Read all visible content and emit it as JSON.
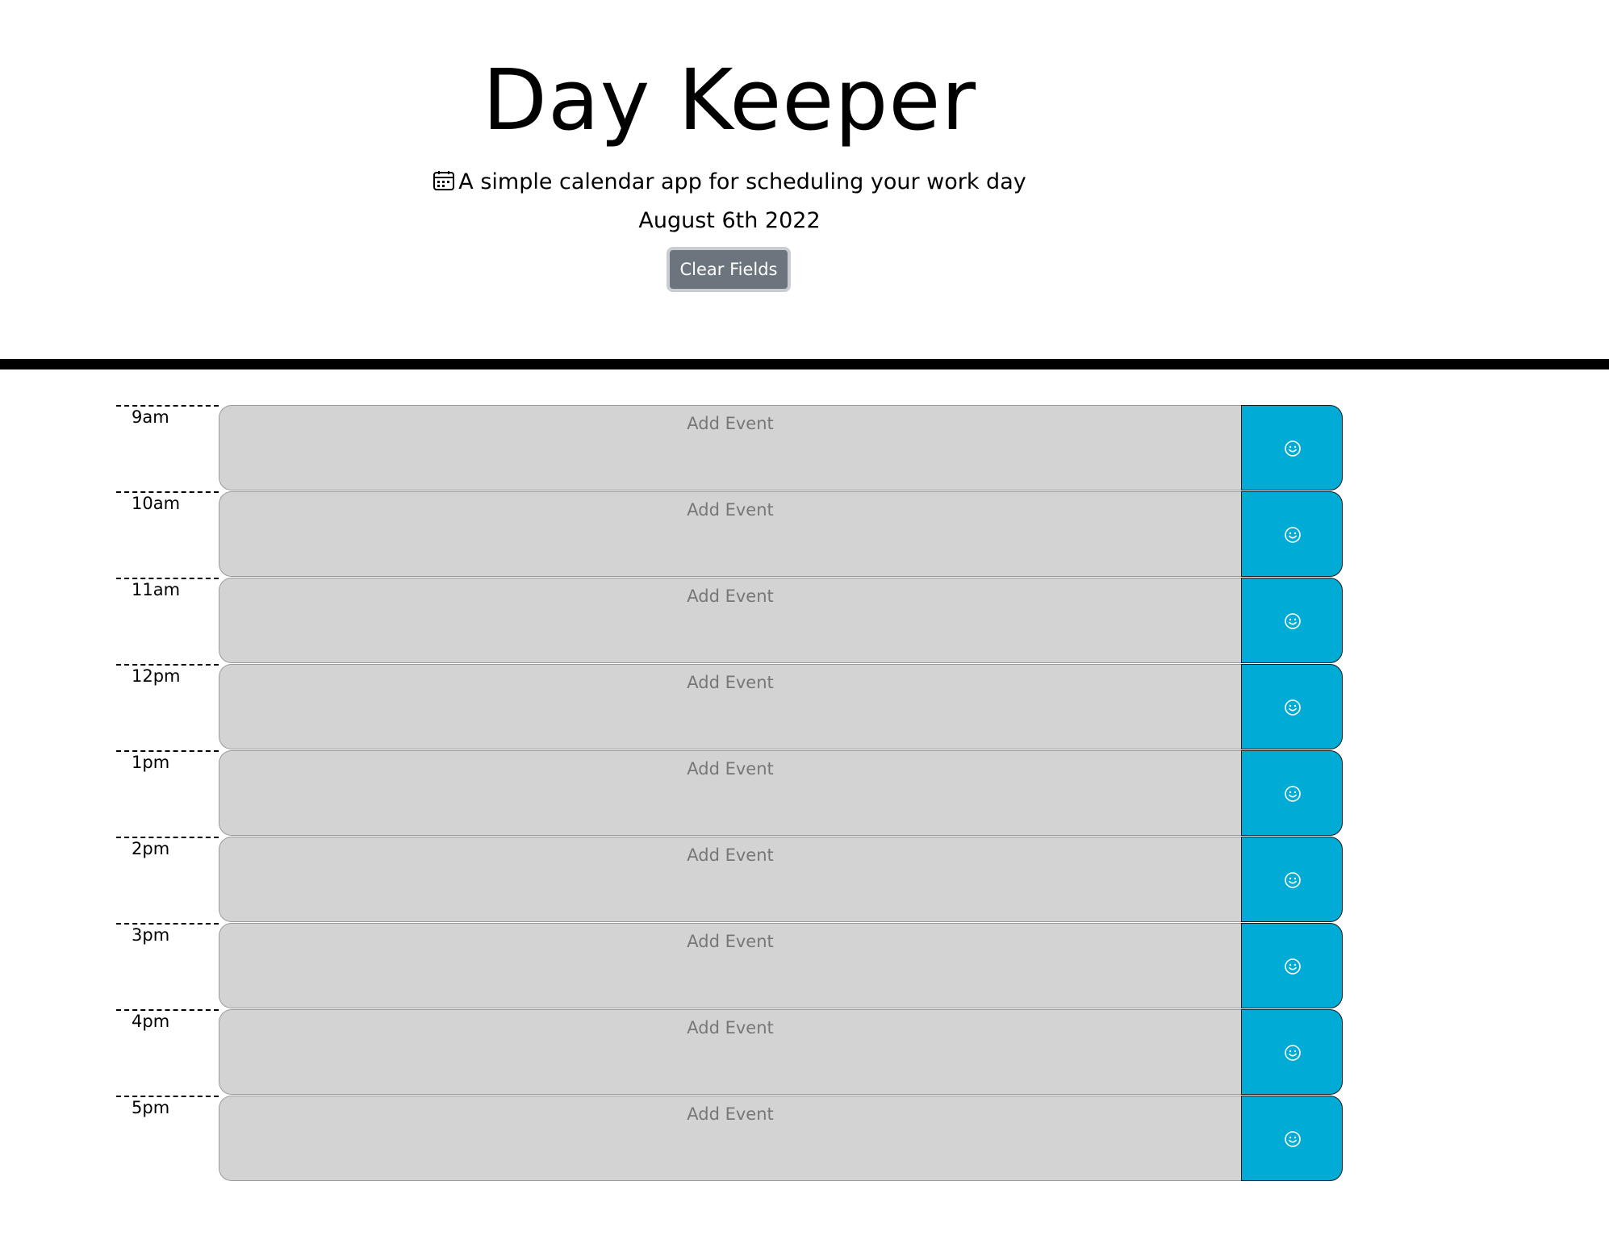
{
  "header": {
    "title": "Day Keeper",
    "tagline": "A simple calendar app for scheduling your work day",
    "tagline_icon": "calendar-icon",
    "current_date": "August 6th 2022",
    "clear_button_label": "Clear Fields"
  },
  "planner": {
    "input_placeholder": "Add Event",
    "save_icon": "smiley-face-icon",
    "colors": {
      "input_background": "#d3d3d3",
      "save_button": "#00acd6",
      "clear_button": "#6c757d"
    },
    "rows": [
      {
        "hour": "9am",
        "value": ""
      },
      {
        "hour": "10am",
        "value": ""
      },
      {
        "hour": "11am",
        "value": ""
      },
      {
        "hour": "12pm",
        "value": ""
      },
      {
        "hour": "1pm",
        "value": ""
      },
      {
        "hour": "2pm",
        "value": ""
      },
      {
        "hour": "3pm",
        "value": ""
      },
      {
        "hour": "4pm",
        "value": ""
      },
      {
        "hour": "5pm",
        "value": ""
      }
    ]
  }
}
